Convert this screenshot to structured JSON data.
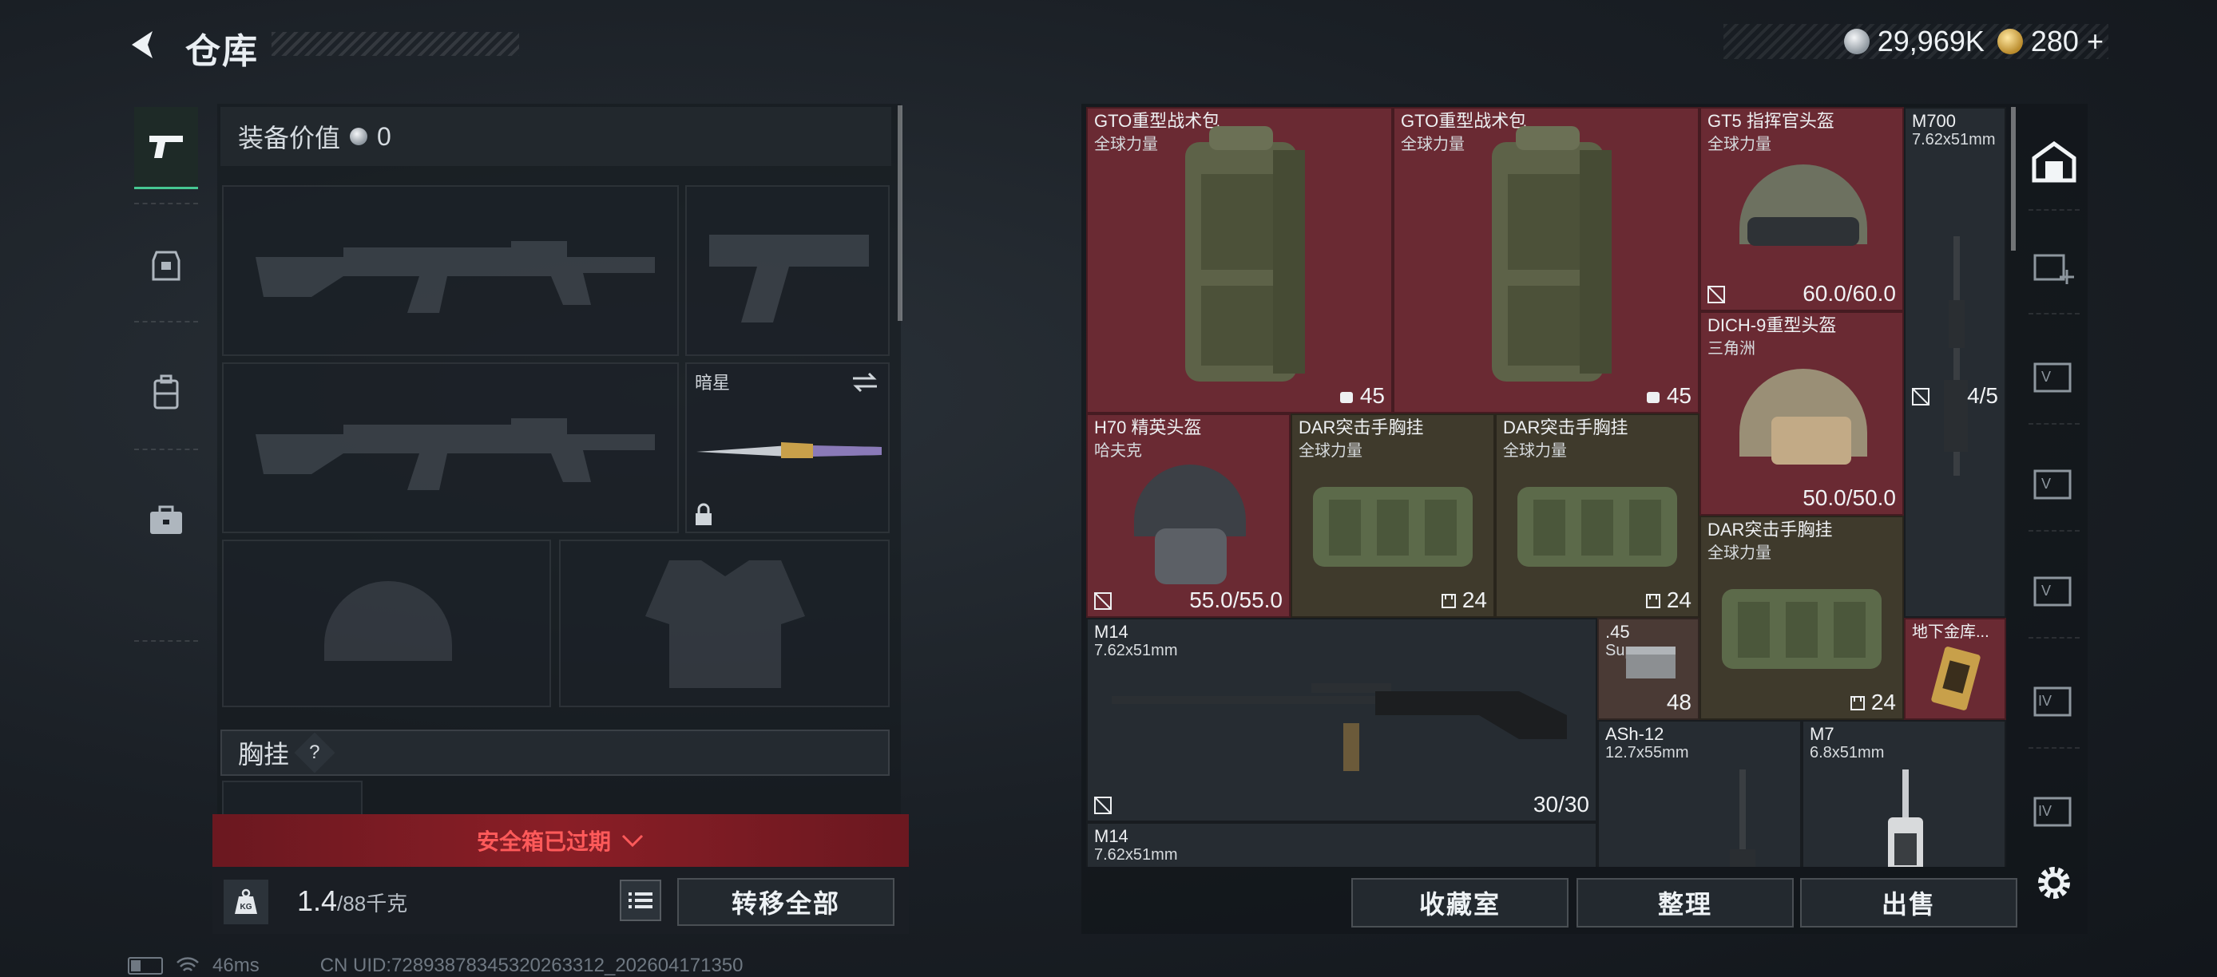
{
  "header": {
    "title": "仓库",
    "silver_amount": "29,969K",
    "gold_amount": "280",
    "gold_plus": "+"
  },
  "loadout": {
    "equip_value_label": "装备价值",
    "equip_value": "0",
    "melee_slot_name": "暗星",
    "chest_rig_label": "胸挂",
    "chest_help": "?",
    "safe_box_status": "安全箱已过期",
    "weight_current": "1.4",
    "weight_max": "/88千克",
    "weight_unit_icon": "KG",
    "transfer_all": "转移全部"
  },
  "stash_items": [
    {
      "name": "GTO重型战术包",
      "sub": "全球力量",
      "value": "45"
    },
    {
      "name": "GTO重型战术包",
      "sub": "全球力量",
      "value": "45"
    },
    {
      "name": "GT5 指挥官头盔",
      "sub": "全球力量",
      "value": "60.0/60.0"
    },
    {
      "name": "M700",
      "sub": "7.62x51mm",
      "value": "4/5"
    },
    {
      "name": "DICH-9重型头盔",
      "sub": "三角洲",
      "value": "50.0/50.0"
    },
    {
      "name": "H70 精英头盔",
      "sub": "哈夫克",
      "value": "55.0/55.0"
    },
    {
      "name": "DAR突击手胸挂",
      "sub": "全球力量",
      "value": "24"
    },
    {
      "name": "DAR突击手胸挂",
      "sub": "全球力量",
      "value": "24"
    },
    {
      "name": "DAR突击手胸挂",
      "sub": "全球力量",
      "value": "24"
    },
    {
      "name": "M14",
      "sub": "7.62x51mm",
      "value": "30/30"
    },
    {
      "name": ".45",
      "sub": "Sup",
      "value": "48"
    },
    {
      "name": "地下金库...",
      "sub": "",
      "value": ""
    },
    {
      "name": "ASh-12",
      "sub": "12.7x55mm",
      "value": ""
    },
    {
      "name": "M7",
      "sub": "6.8x51mm",
      "value": ""
    },
    {
      "name": "M14",
      "sub": "7.62x51mm",
      "value": ""
    }
  ],
  "stash_buttons": {
    "collection": "收藏室",
    "organize": "整理",
    "sell": "出售"
  },
  "right_tabs": [
    "home-icon",
    "add-stash-icon",
    "v-stash-icon",
    "v-stash-icon",
    "v-stash-icon",
    "iv-stash-icon",
    "iv-stash-icon"
  ],
  "footer": {
    "ping": "46ms",
    "uid": "CN UID:72893878345320263312_202604171350"
  },
  "colors": {
    "accent_green": "#46c792",
    "rare_red": "#6a2a33",
    "olive": "#3f3a2c",
    "alert_red": "#ff5a5a"
  }
}
